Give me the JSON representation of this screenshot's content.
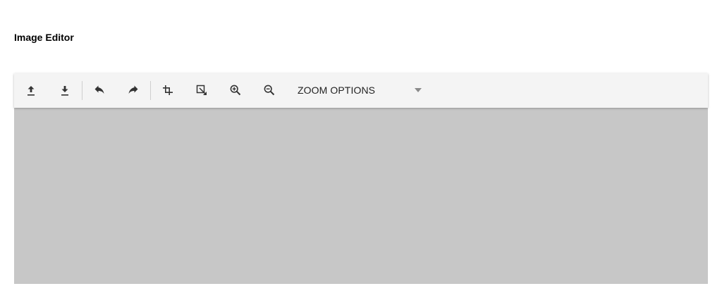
{
  "page": {
    "title": "Image Editor"
  },
  "toolbar": {
    "buttons": [
      {
        "name": "open",
        "icon": "upload-icon"
      },
      {
        "name": "save",
        "icon": "download-icon"
      },
      {
        "name": "undo",
        "icon": "undo-icon"
      },
      {
        "name": "redo",
        "icon": "redo-icon"
      },
      {
        "name": "crop",
        "icon": "crop-icon"
      },
      {
        "name": "transform",
        "icon": "transform-icon"
      },
      {
        "name": "zoom-in",
        "icon": "zoom-in-icon"
      },
      {
        "name": "zoom-out",
        "icon": "zoom-out-icon"
      }
    ],
    "zoom_dropdown": {
      "selected": "ZOOM OPTIONS",
      "icon": "caret-down-icon"
    }
  },
  "colors": {
    "toolbar_bg": "#f4f4f4",
    "canvas_bg": "#c7c7c7",
    "icon": "#333333",
    "caret": "#8a8a8a"
  }
}
